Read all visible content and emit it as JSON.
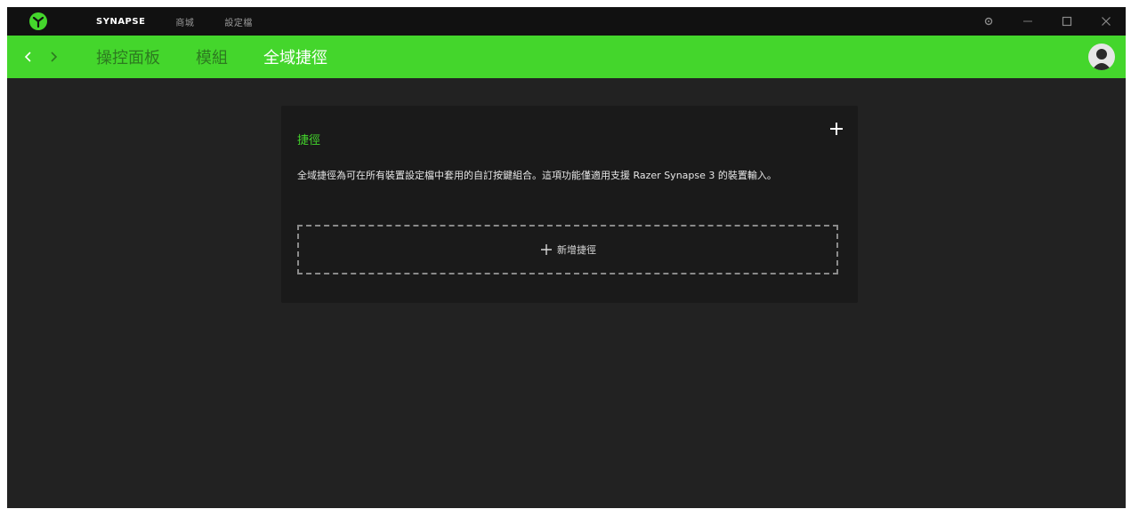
{
  "app": {
    "brand_color": "#44d62c",
    "titlebar_nav": [
      "SYNAPSE",
      "商城",
      "設定檔"
    ]
  },
  "window_controls": {
    "icons": [
      "gear-icon",
      "minimize-icon",
      "maximize-icon",
      "close-icon"
    ]
  },
  "subnav": {
    "tabs": [
      "操控面板",
      "模組",
      "全域捷徑"
    ],
    "active_tab": "全域捷徑"
  },
  "card": {
    "title": "捷徑",
    "description": "全域捷徑為可在所有裝置設定檔中套用的自訂按鍵組合。這項功能僅適用支援 Razer Synapse 3 的裝置輸入。",
    "add_label": "新增捷徑"
  }
}
